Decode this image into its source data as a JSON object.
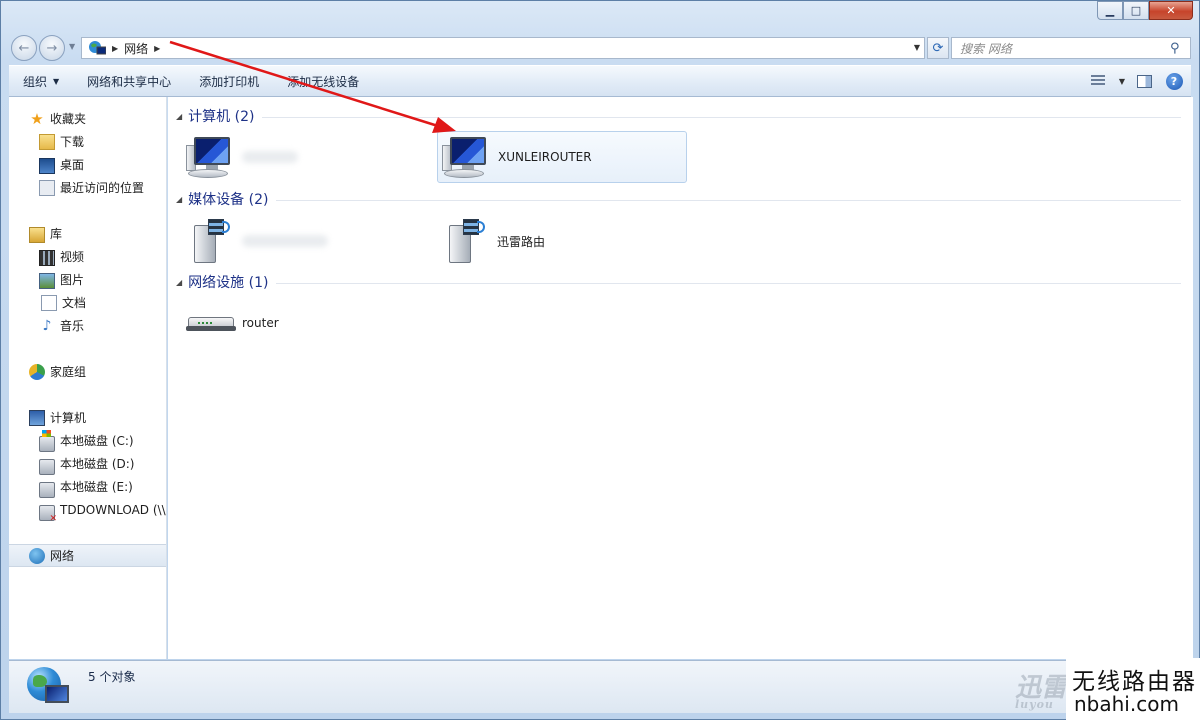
{
  "address": {
    "path": [
      "网络"
    ]
  },
  "search": {
    "placeholder": "搜索 网络"
  },
  "toolbar": {
    "organize": "组织",
    "network_sharing": "网络和共享中心",
    "add_printer": "添加打印机",
    "add_wireless": "添加无线设备"
  },
  "sidebar": {
    "favorites": {
      "label": "收藏夹",
      "items": [
        {
          "label": "下载"
        },
        {
          "label": "桌面"
        },
        {
          "label": "最近访问的位置"
        }
      ]
    },
    "libraries": {
      "label": "库",
      "items": [
        {
          "label": "视频"
        },
        {
          "label": "图片"
        },
        {
          "label": "文档"
        },
        {
          "label": "音乐"
        }
      ]
    },
    "homegroup": {
      "label": "家庭组"
    },
    "computer": {
      "label": "计算机",
      "items": [
        {
          "label": "本地磁盘 (C:)"
        },
        {
          "label": "本地磁盘 (D:)"
        },
        {
          "label": "本地磁盘 (E:)"
        },
        {
          "label": "TDDOWNLOAD (\\\\"
        }
      ]
    },
    "network": {
      "label": "网络"
    }
  },
  "groups": [
    {
      "title": "计算机 (2)",
      "items": [
        {
          "label": ""
        },
        {
          "label": "XUNLEIROUTER"
        }
      ]
    },
    {
      "title": "媒体设备 (2)",
      "items": [
        {
          "label": ""
        },
        {
          "label": "迅雷路由"
        }
      ]
    },
    {
      "title": "网络设施 (1)",
      "items": [
        {
          "label": "router"
        }
      ]
    }
  ],
  "status": {
    "text": "5 个对象"
  },
  "watermark": {
    "brand": "迅雷",
    "brand_sub": "luyou",
    "title": "无线路由器",
    "url": "nbahi.com"
  },
  "colors": {
    "group_title": "#1e3287",
    "annotation_arrow": "#e01818"
  }
}
